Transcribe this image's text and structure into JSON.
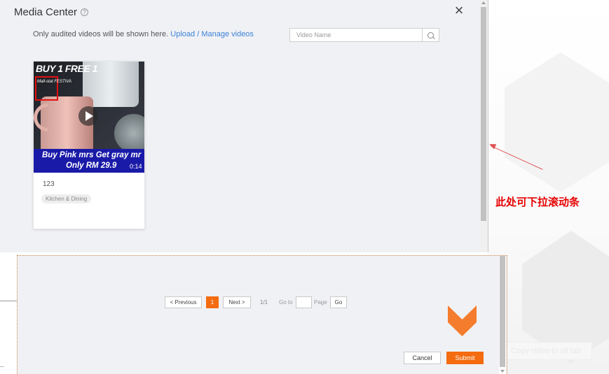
{
  "modal": {
    "title": "Media Center",
    "help_icon": "?",
    "close_label": "×",
    "notice_text": "Only audited videos will be shown here.",
    "notice_link": "Upload / Manage videos",
    "search": {
      "placeholder": "Video Name",
      "value": ""
    }
  },
  "videos": [
    {
      "name": "123",
      "category": "Kitchen & Dining",
      "duration": "0:14",
      "thumbnail_promo": "BUY 1 FREE 1",
      "thumbnail_logo": "Mall-stat FESTIVA",
      "banner_line1": "Buy Pink mrs Get gray mr",
      "banner_line2": "Only RM 29.9"
    }
  ],
  "pagination": {
    "previous_label": "< Previous",
    "current_page": "1",
    "next_label": "Next >",
    "page_info": "1/1",
    "goto_label": "Go to",
    "page_label": "Page",
    "go_button": "Go",
    "goto_value": ""
  },
  "footer": {
    "cancel_label": "Cancel",
    "submit_label": "Submit",
    "faint_button_text": "Copy video to all tab"
  },
  "annotation": {
    "text": "此处可下拉滚动条",
    "color": "#e60000"
  },
  "colors": {
    "accent": "#f46b10",
    "link": "#3b82d6",
    "modal_bg": "#f0f1f5"
  }
}
